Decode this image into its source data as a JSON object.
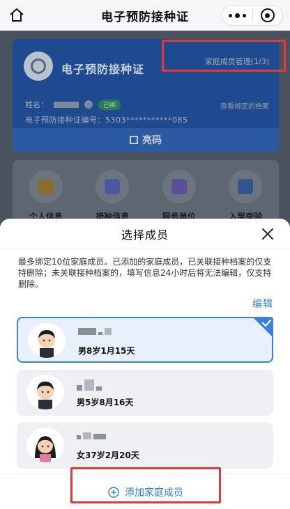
{
  "nav": {
    "title": "电子预防接种证",
    "home_icon": "home-icon",
    "more_icon": "more-dots-icon",
    "close_icon": "mini-close-icon"
  },
  "card": {
    "title": "电子预防接种证",
    "family_manage": "家庭成员管理(1/3)",
    "name_label": "姓名：",
    "bound_badge": "已绑",
    "bound_link": "查看绑定的档案",
    "cert_no": "电子预防接种证编号：5303***********085",
    "qr_label": "亮码"
  },
  "grid": [
    {
      "label": "个人信息",
      "icon": "id-card-icon",
      "color": "#8a6d2f"
    },
    {
      "label": "接种信息",
      "icon": "syringe-icon",
      "color": "#4a5a9c"
    },
    {
      "label": "服务单位",
      "icon": "building-icon",
      "color": "#5b4f9a"
    },
    {
      "label": "入学查验",
      "icon": "graduation-cap-icon",
      "color": "#35538f"
    }
  ],
  "sheet": {
    "title": "选择成员",
    "notice": "最多绑定10位家庭成员。已添加的家庭成员，已关联接种档案的仅支持删除；未关联接种档案的，填写信息24小时后将无法编辑，仅支持删除。",
    "edit_label": "编辑",
    "members": [
      {
        "info": "男8岁1月15天",
        "selected": true,
        "avatar": "boy-avatar-icon"
      },
      {
        "info": "男5岁8月16天",
        "selected": false,
        "avatar": "boy-avatar-icon"
      },
      {
        "info": "女37岁2月20天",
        "selected": false,
        "avatar": "woman-avatar-icon"
      }
    ],
    "add_label": "添加家庭成员"
  },
  "colors": {
    "accent": "#2f7ad6",
    "highlight": "#e53935",
    "card": "#1f4a8f"
  }
}
